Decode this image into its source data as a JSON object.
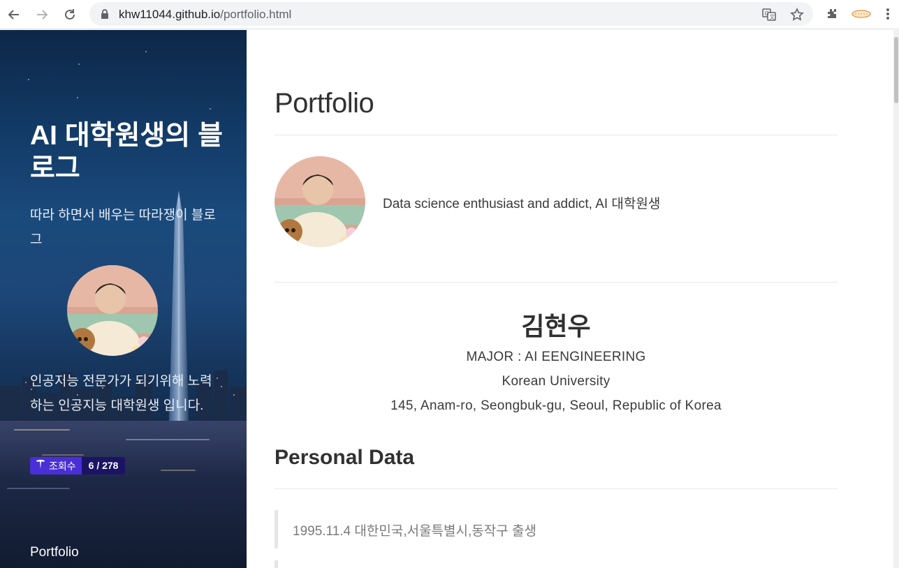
{
  "browser": {
    "url_host": "khw11044.github.io",
    "url_path": "/portfolio.html",
    "icons": {
      "back": "arrow-left-icon",
      "forward": "arrow-right-icon",
      "reload": "reload-icon",
      "lock": "lock-icon",
      "translate": "translate-icon",
      "bookmark": "star-icon",
      "extensions": "puzzle-icon",
      "profile": "profile-extension-icon",
      "menu": "kebab-menu-icon"
    }
  },
  "sidebar": {
    "title": "AI 대학원생의 블로그",
    "description": "따라 하면서 배우는 따라쟁이 블로그",
    "bio": "인공지능 전문가가 되기위해 노력하는 인공지능 대학원생 입니다.",
    "views_label": "조회수",
    "views_count": "6 / 278",
    "nav_items": [
      {
        "label": "Portfolio"
      }
    ]
  },
  "main": {
    "page_title": "Portfolio",
    "tagline": "Data science enthusiast and addict, AI 대학원생",
    "name": "김현우",
    "major": "MAJOR : AI EENGINEERING",
    "university": "Korean University",
    "address": "145, Anam-ro, Seongbuk-gu, Seoul, Republic of Korea",
    "section_personal": "Personal Data",
    "personal_items": [
      "1995.11.4 대한민국,서울특별시,동작구 출생"
    ]
  },
  "colors": {
    "badge_label": "#4a2fd6",
    "badge_count": "#1b1464",
    "heading_text": "#313131"
  }
}
